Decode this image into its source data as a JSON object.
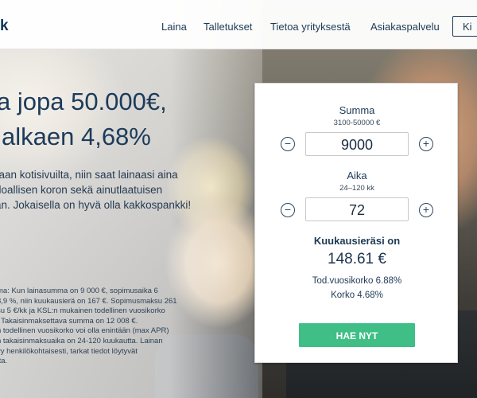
{
  "nav": {
    "logo_fragment": "k",
    "items": [
      "Laina",
      "Talletukset",
      "Tietoa yrityksestä",
      "Asiakaspalvelu"
    ],
    "cta_label": "Ki"
  },
  "hero": {
    "headline_line1": "a jopa 50.000€,",
    "headline_line2": "alkaen 4,68%",
    "subtext_lines": [
      "raan kotisivuilta, niin saat lainaasi aina",
      "doallisen koron sekä ainutlaatuisen",
      "an. Jokaisella on hyvä olla kakkospankki!"
    ],
    "legal_lines": [
      "ma: Kun lainasumma on 9 000 €, sopimusaika 6",
      " 8,9 %, niin kuukausierä on 167 €. Sopimusmaksu 261",
      "su 5 €/kk ja KSL:n mukainen todellinen vuosikorko",
      ". Takaisinmaksettava summa on 12 008 €.",
      "n todellinen vuosikorko voi olla enintään (max APR)",
      "n takaisinmaksuaika on 24-120 kuukautta. Lainan",
      "yy henkilökohtaisesti, tarkat tiedot löytyvät",
      "tta."
    ]
  },
  "calculator": {
    "amount_label": "Summa",
    "amount_range": "3100-50000 €",
    "amount_value": "9000",
    "time_label": "Aika",
    "time_range": "24–120 kk",
    "time_value": "72",
    "monthly_label": "Kuukausieräsi on",
    "monthly_value": "148.61 €",
    "effective_rate": "Tod.vuosikorko 6.88%",
    "rate": "Korko 4.68%",
    "apply_label": "HAE NYT",
    "minus_glyph": "−",
    "plus_glyph": "+"
  },
  "colors": {
    "brand_navy": "#1c3b5a",
    "accent_green": "#3fbf86"
  },
  "icons": [
    "minus-circle-icon",
    "plus-circle-icon"
  ]
}
